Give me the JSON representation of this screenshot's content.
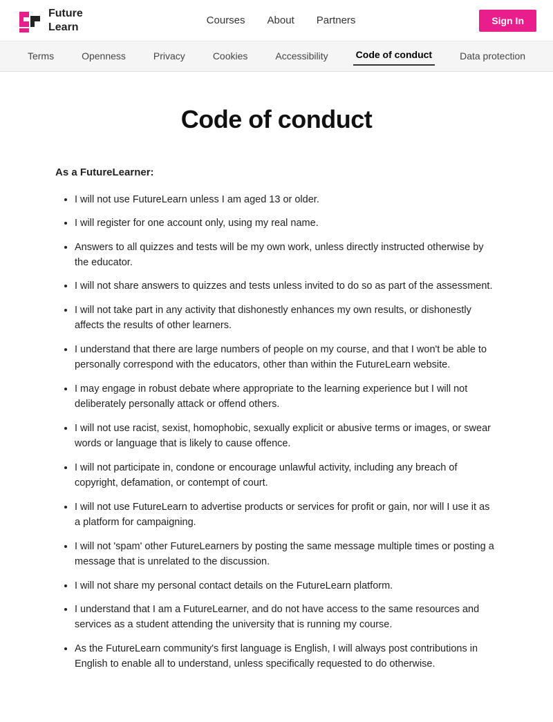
{
  "header": {
    "logo_line1": "Future",
    "logo_line2": "Learn",
    "nav": {
      "courses": "Courses",
      "about": "About",
      "partners": "Partners"
    },
    "signin": "Sign In"
  },
  "subnav": {
    "items": [
      {
        "label": "Terms",
        "active": false
      },
      {
        "label": "Openness",
        "active": false
      },
      {
        "label": "Privacy",
        "active": false
      },
      {
        "label": "Cookies",
        "active": false
      },
      {
        "label": "Accessibility",
        "active": false
      },
      {
        "label": "Code of conduct",
        "active": true
      },
      {
        "label": "Data protection",
        "active": false
      }
    ]
  },
  "page": {
    "title": "Code of conduct",
    "intro": "As a FutureLearner:",
    "rules": [
      "I will not use FutureLearn unless I am aged 13 or older.",
      "I will register for one account only, using my real name.",
      "Answers to all quizzes and tests will be my own work, unless directly instructed otherwise by the educator.",
      "I will not share answers to quizzes and tests unless invited to do so as part of the assessment.",
      "I will not take part in any activity that dishonestly enhances my own results, or dishonestly affects the results of other learners.",
      "I understand that there are large numbers of people on my course, and that I won't be able to personally correspond with the educators, other than within the FutureLearn website.",
      "I may engage in robust debate where appropriate to the learning experience but I will not deliberately personally attack or offend others.",
      "I will not use racist, sexist, homophobic, sexually explicit or abusive terms or images, or swear words or language that is likely to cause offence.",
      "I will not participate in, condone or encourage unlawful activity, including any breach of copyright, defamation, or contempt of court.",
      "I will not use FutureLearn to advertise products or services for profit or gain, nor will I use it as a platform for campaigning.",
      "I will not 'spam' other FutureLearners by posting the same message multiple times or posting a message that is unrelated to the discussion.",
      "I will not share my personal contact details on the FutureLearn platform.",
      "I understand that I am a FutureLearner, and do not have access to the same resources and services as a student attending the university that is running my course.",
      "As the FutureLearn community's first language is English, I will always post contributions in English to enable all to understand, unless specifically requested to do otherwise."
    ]
  }
}
